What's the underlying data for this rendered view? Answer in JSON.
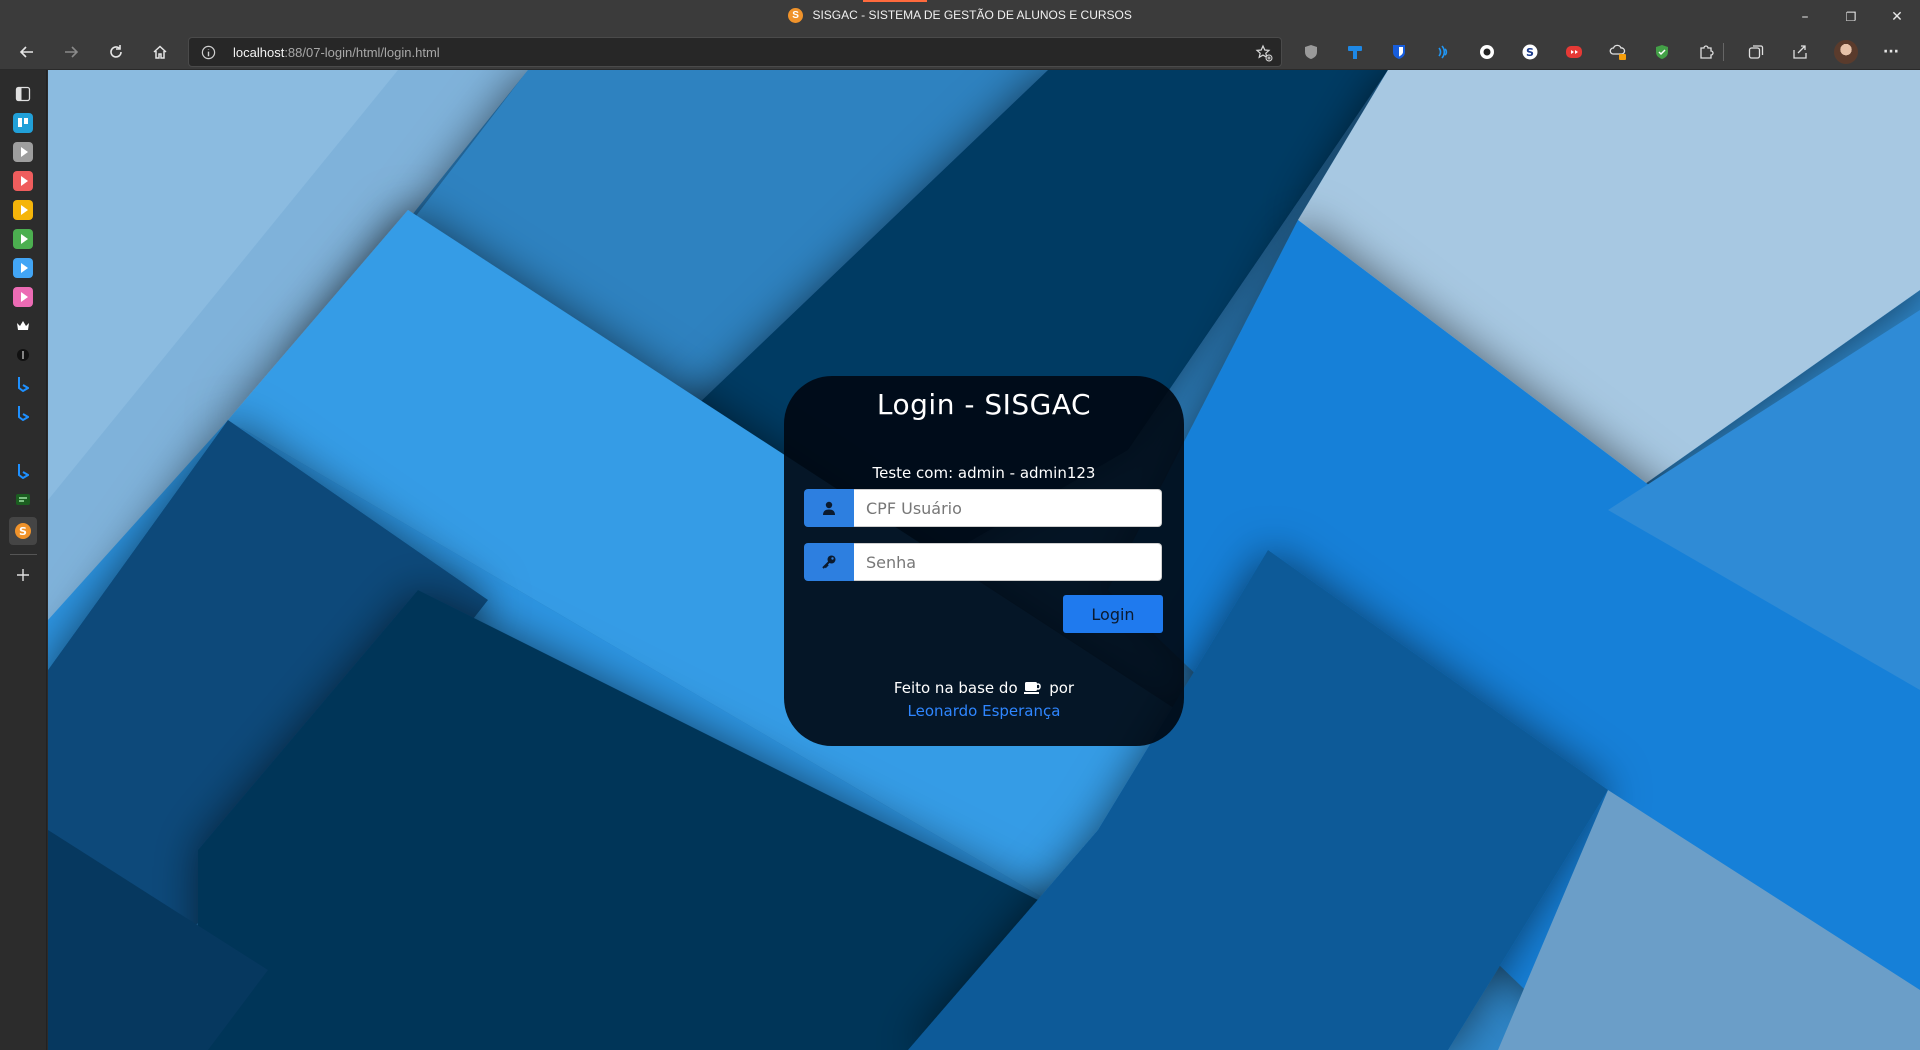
{
  "window": {
    "title": "SISGAC - SISTEMA DE GESTÃO DE ALUNOS E CURSOS",
    "favicon_letter": "S",
    "controls": {
      "minimize": "–",
      "restore": "❐",
      "close": "✕"
    }
  },
  "toolbar": {
    "url_host": "localhost",
    "url_rest": ":88/07-login/html/login.html",
    "extensions": [
      "shield-extension-icon",
      "translate-extension-icon",
      "bitwarden-extension-icon",
      "wifi-extension-icon",
      "circle-extension-icon",
      "s-extension-icon",
      "red-extension-icon",
      "cloud-extension-icon",
      "green-shield-extension-icon",
      "puzzle-icon",
      "collections-icon",
      "share-icon"
    ],
    "menu_label": "···"
  },
  "sidebar": {
    "items": [
      "tabs-icon",
      "trello-icon",
      "video-gray-icon",
      "video-red-icon",
      "video-yellow-icon",
      "video-green-icon",
      "video-blue-icon",
      "video-pink-icon",
      "crown-icon",
      "dark-circle-icon",
      "bing-icon",
      "bing-icon",
      "bing-icon",
      "whatsapp-icon",
      "sisgac-icon",
      "add-icon"
    ],
    "accent_colors": [
      "#9e9e9e",
      "#ef5d5d",
      "#f5b50a",
      "#4caf50",
      "#42a5f5",
      "#ec6bb4"
    ]
  },
  "login": {
    "title": "Login - SISGAC",
    "hint": "Teste com: admin - admin123",
    "user_placeholder": "CPF Usuário",
    "password_placeholder": "Senha",
    "button_label": "Login",
    "footer_text_before": "Feito na base do",
    "footer_text_after": "por",
    "author_link": "Leonardo Esperança"
  },
  "colors": {
    "accent": "#2d7fe0",
    "link": "#2f86ff",
    "card_bg": "#00080e"
  }
}
